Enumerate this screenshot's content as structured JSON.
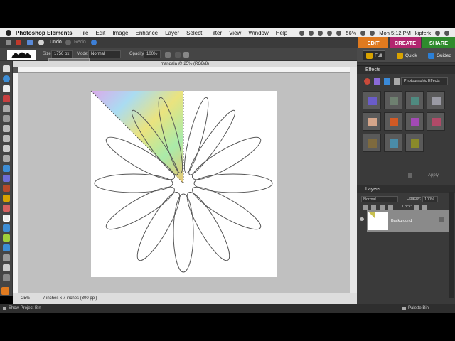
{
  "menubar": {
    "app_name": "Photoshop Elements",
    "menus": [
      "File",
      "Edit",
      "Image",
      "Enhance",
      "Layer",
      "Select",
      "Filter",
      "View",
      "Window",
      "Help"
    ],
    "battery": "56%",
    "clock": "Mon 5:12 PM",
    "user": "kipferk"
  },
  "toolbar": {
    "undo_label": "Undo",
    "redo_label": "Redo"
  },
  "modes": {
    "edit": "EDIT",
    "create": "CREATE",
    "share": "SHARE",
    "full": "Full",
    "quick": "Quick",
    "guided": "Guided"
  },
  "options": {
    "size_label": "Size:",
    "size_value": "1756 px",
    "mode_label": "Mode:",
    "mode_value": "Normal",
    "opacity_label": "Opacity:",
    "opacity_value": "100%"
  },
  "document": {
    "tab_title": "mandala @ 25% (RGB/8)",
    "zoom": "25%",
    "doc_size": "7 inches x 7 inches (300 ppi)"
  },
  "effects": {
    "title": "Effects",
    "category": "Photographic Effects",
    "apply_label": "Apply",
    "swatches": [
      "#6a5cc8",
      "#6e8070",
      "#4f8a80",
      "#9a9aa4",
      "#d4a58a",
      "#d25a25",
      "#a24ab4",
      "#b04a68",
      "#7e6a3e",
      "#4a8ca8",
      "#8a8a2a"
    ]
  },
  "layers": {
    "title": "Layers",
    "blend_mode": "Normal",
    "opacity_label": "Opacity:",
    "opacity_value": "100%",
    "lock_label": "Lock:",
    "layer_name": "Background"
  },
  "bottombar": {
    "project_bin": "Show Project Bin",
    "palette_bin": "Palette Bin"
  },
  "colors": {
    "edit_tab": "#e07a1f",
    "create_tab": "#b2266f",
    "share_tab": "#2f8b2d",
    "foreground": "#e07a1f"
  }
}
